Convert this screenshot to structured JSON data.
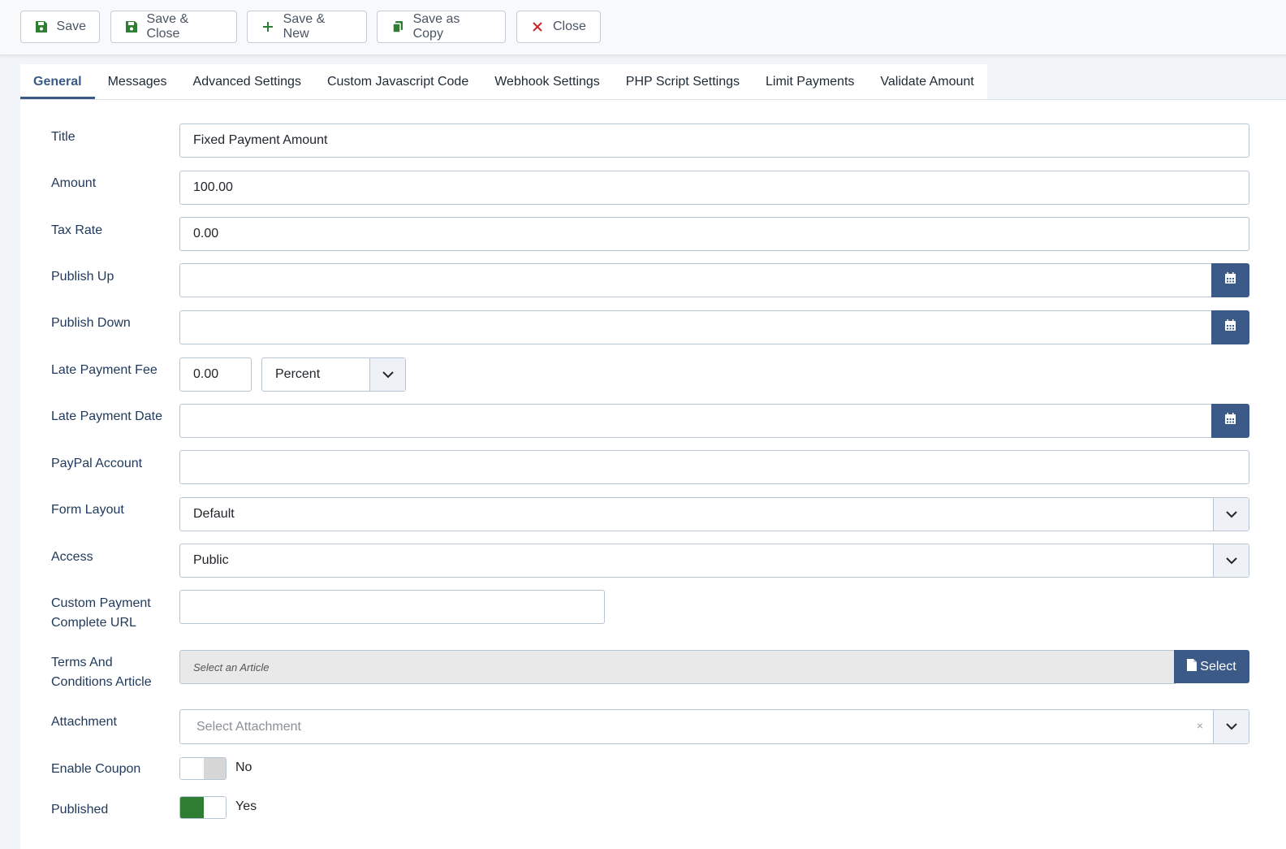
{
  "toolbar": {
    "save": "Save",
    "save_close": "Save & Close",
    "save_new": "Save & New",
    "save_copy": "Save as Copy",
    "close": "Close"
  },
  "tabs": [
    "General",
    "Messages",
    "Advanced Settings",
    "Custom Javascript Code",
    "Webhook Settings",
    "PHP Script Settings",
    "Limit Payments",
    "Validate Amount"
  ],
  "form": {
    "title": {
      "label": "Title",
      "value": "Fixed Payment Amount"
    },
    "amount": {
      "label": "Amount",
      "value": "100.00"
    },
    "tax_rate": {
      "label": "Tax Rate",
      "value": "0.00"
    },
    "publish_up": {
      "label": "Publish Up",
      "value": ""
    },
    "publish_down": {
      "label": "Publish Down",
      "value": ""
    },
    "late_fee": {
      "label": "Late Payment Fee",
      "value": "0.00",
      "type": "Percent"
    },
    "late_date": {
      "label": "Late Payment Date",
      "value": ""
    },
    "paypal": {
      "label": "PayPal Account",
      "value": ""
    },
    "form_layout": {
      "label": "Form Layout",
      "value": "Default"
    },
    "access": {
      "label": "Access",
      "value": "Public"
    },
    "custom_url": {
      "label1": "Custom Payment",
      "label2": "Complete URL",
      "value": ""
    },
    "terms": {
      "label1": "Terms And",
      "label2": "Conditions Article",
      "placeholder": "Select an Article",
      "button": "Select"
    },
    "attachment": {
      "label": "Attachment",
      "placeholder": "Select Attachment",
      "clear": "×"
    },
    "enable_coupon": {
      "label": "Enable Coupon",
      "state": "No"
    },
    "published": {
      "label": "Published",
      "state": "Yes"
    }
  },
  "colors": {
    "accent": "#3b5a87",
    "save_icon": "#2e7d32",
    "close_icon": "#c62828",
    "toggle_on": "#2e7d32"
  }
}
